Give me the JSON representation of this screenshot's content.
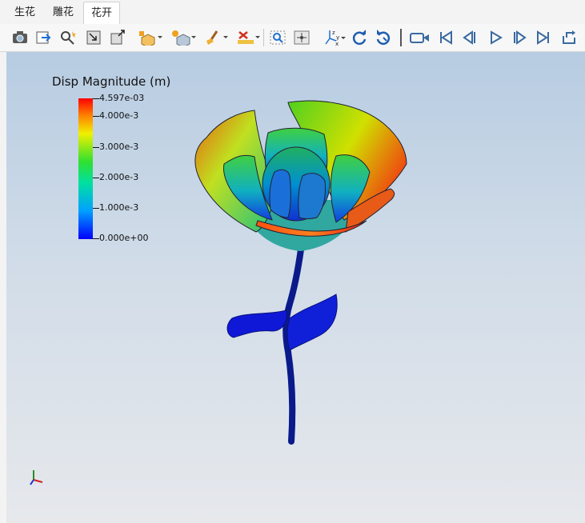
{
  "tabs": [
    {
      "label": "生花"
    },
    {
      "label": "雕花"
    },
    {
      "label": "花开"
    }
  ],
  "active_tab": "花开",
  "toolbar": {
    "tools": [
      "camera-icon",
      "export-icon",
      "zoom-to-selection-icon",
      "reset-view-icon",
      "reset-bounds-icon",
      "interaction-mode-icon",
      "representation-icon",
      "clear-icon",
      "ruler-icon",
      "zoom-box-icon",
      "center-icon",
      "axes-orientation-icon",
      "rotate-cw-icon",
      "rotate-ccw-icon",
      "camera-record-icon",
      "first-frame-icon",
      "prev-frame-icon",
      "play-icon",
      "next-frame-icon",
      "last-frame-icon",
      "loop-icon"
    ]
  },
  "legend": {
    "title": "Disp Magnitude (m)",
    "max_label": "4.597e-03",
    "labels": [
      "4.000e-3",
      "3.000e-3",
      "2.000e-3",
      "1.000e-3"
    ],
    "min_label": "0.000e+00"
  },
  "colors": {
    "accent": "#1f6fd0",
    "max": "#ff0000",
    "min": "#0000ff"
  }
}
